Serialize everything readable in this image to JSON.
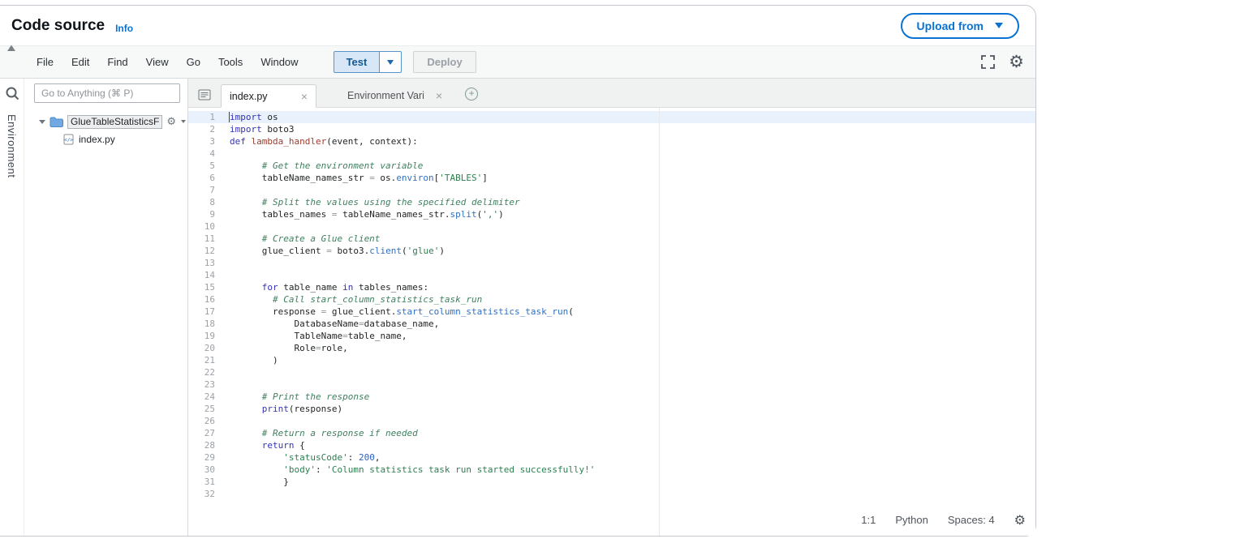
{
  "header": {
    "title": "Code source",
    "info_label": "Info",
    "upload_label": "Upload from"
  },
  "menubar": {
    "items": [
      "File",
      "Edit",
      "Find",
      "View",
      "Go",
      "Tools",
      "Window"
    ],
    "test_label": "Test",
    "deploy_label": "Deploy"
  },
  "sidebar": {
    "environment_label": "Environment",
    "search_placeholder": "Go to Anything (⌘ P)",
    "folder_label": "GlueTableStatisticsF",
    "file_label": "index.py"
  },
  "tabs": [
    {
      "label": "index.py",
      "active": true
    },
    {
      "label": "Environment Vari",
      "active": false
    }
  ],
  "status": {
    "cursor": "1:1",
    "language": "Python",
    "spaces": "Spaces: 4"
  },
  "icons": {
    "gear": "⚙",
    "close": "×",
    "plus": "+"
  },
  "colors": {
    "accent": "#0972d3",
    "active_line": "#e9f1fc",
    "comment": "#40805f",
    "string": "#2d7f4f",
    "keyword": "#3333b8"
  },
  "editor": {
    "lines": [
      [
        [
          "import",
          "k"
        ],
        [
          " os",
          "p"
        ]
      ],
      [
        [
          "import",
          "k"
        ],
        [
          " boto3",
          "p"
        ]
      ],
      [
        [
          "def",
          "k"
        ],
        [
          " ",
          "p"
        ],
        [
          "lambda_handler",
          "f"
        ],
        [
          "(event, context):",
          "p"
        ]
      ],
      [],
      [
        [
          "      # Get the environment variable",
          "c"
        ]
      ],
      [
        [
          "      tableName_names_str ",
          "p"
        ],
        [
          "=",
          "o"
        ],
        [
          " os.",
          "p"
        ],
        [
          "environ",
          "m"
        ],
        [
          "[",
          "p"
        ],
        [
          "'TABLES'",
          "s"
        ],
        [
          "]",
          "p"
        ]
      ],
      [],
      [
        [
          "      # Split the values using the specified delimiter",
          "c"
        ]
      ],
      [
        [
          "      tables_names ",
          "p"
        ],
        [
          "=",
          "o"
        ],
        [
          " tableName_names_str.",
          "p"
        ],
        [
          "split",
          "m"
        ],
        [
          "(",
          "p"
        ],
        [
          "','",
          "s"
        ],
        [
          ")",
          "p"
        ]
      ],
      [],
      [
        [
          "      # Create a Glue client",
          "c"
        ]
      ],
      [
        [
          "      glue_client ",
          "p"
        ],
        [
          "=",
          "o"
        ],
        [
          " boto3.",
          "p"
        ],
        [
          "client",
          "m"
        ],
        [
          "(",
          "p"
        ],
        [
          "'glue'",
          "s"
        ],
        [
          ")",
          "p"
        ]
      ],
      [],
      [],
      [
        [
          "      ",
          "p"
        ],
        [
          "for",
          "k"
        ],
        [
          " table_name ",
          "p"
        ],
        [
          "in",
          "k"
        ],
        [
          " tables_names:",
          "p"
        ]
      ],
      [
        [
          "        # Call start_column_statistics_task_run",
          "c"
        ]
      ],
      [
        [
          "        response ",
          "p"
        ],
        [
          "=",
          "o"
        ],
        [
          " glue_client.",
          "p"
        ],
        [
          "start_column_statistics_task_run",
          "m"
        ],
        [
          "(",
          "p"
        ]
      ],
      [
        [
          "            DatabaseName",
          "p"
        ],
        [
          "=",
          "o"
        ],
        [
          "database_name,",
          "p"
        ]
      ],
      [
        [
          "            TableName",
          "p"
        ],
        [
          "=",
          "o"
        ],
        [
          "table_name,",
          "p"
        ]
      ],
      [
        [
          "            Role",
          "p"
        ],
        [
          "=",
          "o"
        ],
        [
          "role,",
          "p"
        ]
      ],
      [
        [
          "        )",
          "p"
        ]
      ],
      [],
      [],
      [
        [
          "      # Print the response",
          "c"
        ]
      ],
      [
        [
          "      ",
          "p"
        ],
        [
          "print",
          "k"
        ],
        [
          "(response)",
          "p"
        ]
      ],
      [],
      [
        [
          "      # Return a response if needed",
          "c"
        ]
      ],
      [
        [
          "      ",
          "p"
        ],
        [
          "return",
          "k"
        ],
        [
          " {",
          "p"
        ]
      ],
      [
        [
          "          ",
          "p"
        ],
        [
          "'statusCode'",
          "s"
        ],
        [
          ": ",
          "p"
        ],
        [
          "200",
          "d"
        ],
        [
          ",",
          "p"
        ]
      ],
      [
        [
          "          ",
          "p"
        ],
        [
          "'body'",
          "s"
        ],
        [
          ": ",
          "p"
        ],
        [
          "'Column statistics task run started successfully!'",
          "s"
        ]
      ],
      [
        [
          "          }",
          "p"
        ]
      ],
      []
    ]
  }
}
